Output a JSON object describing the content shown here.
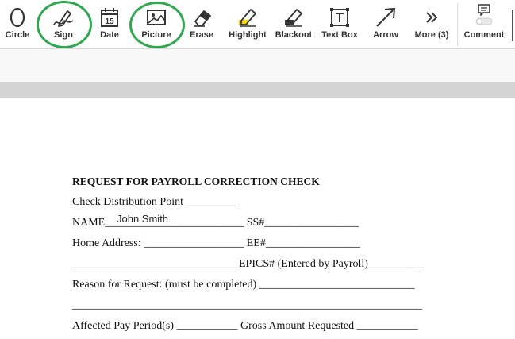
{
  "toolbar": {
    "tools": [
      {
        "id": "circle",
        "label": "Circle",
        "icon": "circle-icon"
      },
      {
        "id": "sign",
        "label": "Sign",
        "icon": "pen-sign-icon"
      },
      {
        "id": "date",
        "label": "Date",
        "icon": "calendar-icon",
        "icon_text": "15"
      },
      {
        "id": "picture",
        "label": "Picture",
        "icon": "picture-icon"
      },
      {
        "id": "erase",
        "label": "Erase",
        "icon": "eraser-icon"
      },
      {
        "id": "highlight",
        "label": "Highlight",
        "icon": "highlighter-icon"
      },
      {
        "id": "blackout",
        "label": "Blackout",
        "icon": "blackout-icon"
      },
      {
        "id": "textbox",
        "label": "Text Box",
        "icon": "textbox-icon"
      },
      {
        "id": "arrow",
        "label": "Arrow",
        "icon": "arrow-icon"
      },
      {
        "id": "more",
        "label": "More (3)",
        "icon": "chevrons-right-icon"
      },
      {
        "id": "comment",
        "label": "Comment",
        "icon": "comment-icon"
      }
    ],
    "highlighted": [
      "sign",
      "picture"
    ],
    "highlight_color": "#2fa84f",
    "accent_yellow": "#f5d800"
  },
  "document": {
    "title": "REQUEST FOR PAYROLL CORRECTION CHECK",
    "lines": [
      "Check Distribution Point _________",
      "NAME_________________________ SS#_________________",
      "Home Address: __________________ EE#_________________",
      "______________________________EPICS# (Entered by Payroll)__________",
      "Reason for Request: (must be completed) ____________________________",
      "_______________________________________________________________",
      "Affected Pay Period(s) ___________ Gross Amount Requested ___________"
    ],
    "filled_name": "John Smith"
  }
}
